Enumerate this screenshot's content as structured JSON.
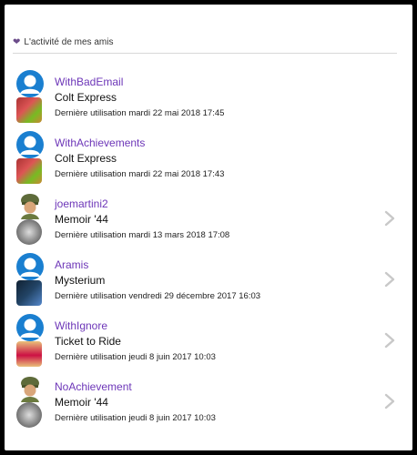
{
  "section": {
    "title": "L'activité de mes amis",
    "icon": "heart-icon"
  },
  "colors": {
    "username": "#6d36b8",
    "icon_purple": "#6b4c8a",
    "avatar_blue": "#1a7fd0",
    "chevron": "#c8c8c8"
  },
  "activities": [
    {
      "user": "WithBadEmail",
      "game": "Colt Express",
      "last_used": "Dernière utilisation mardi 22 mai 2018 17:45",
      "avatar": "user-avatar-icon",
      "thumb": "colt-express",
      "has_chevron": false
    },
    {
      "user": "WithAchievements",
      "game": "Colt Express",
      "last_used": "Dernière utilisation mardi 22 mai 2018 17:43",
      "avatar": "user-avatar-icon",
      "thumb": "colt-express",
      "has_chevron": false
    },
    {
      "user": "joemartini2",
      "game": "Memoir '44",
      "last_used": "Dernière utilisation mardi 13 mars 2018 17:08",
      "avatar": "soldier-avatar",
      "thumb": "memoir-44",
      "has_chevron": true
    },
    {
      "user": "Aramis",
      "game": "Mysterium",
      "last_used": "Dernière utilisation vendredi 29 décembre 2017 16:03",
      "avatar": "user-avatar-icon",
      "thumb": "mysterium",
      "has_chevron": true
    },
    {
      "user": "WithIgnore",
      "game": "Ticket to Ride",
      "last_used": "Dernière utilisation jeudi 8 juin 2017 10:03",
      "avatar": "user-avatar-icon",
      "thumb": "ticket-to-ride",
      "has_chevron": true
    },
    {
      "user": "NoAchievement",
      "game": "Memoir '44",
      "last_used": "Dernière utilisation jeudi 8 juin 2017 10:03",
      "avatar": "soldier-avatar",
      "thumb": "memoir-44",
      "has_chevron": true
    }
  ]
}
